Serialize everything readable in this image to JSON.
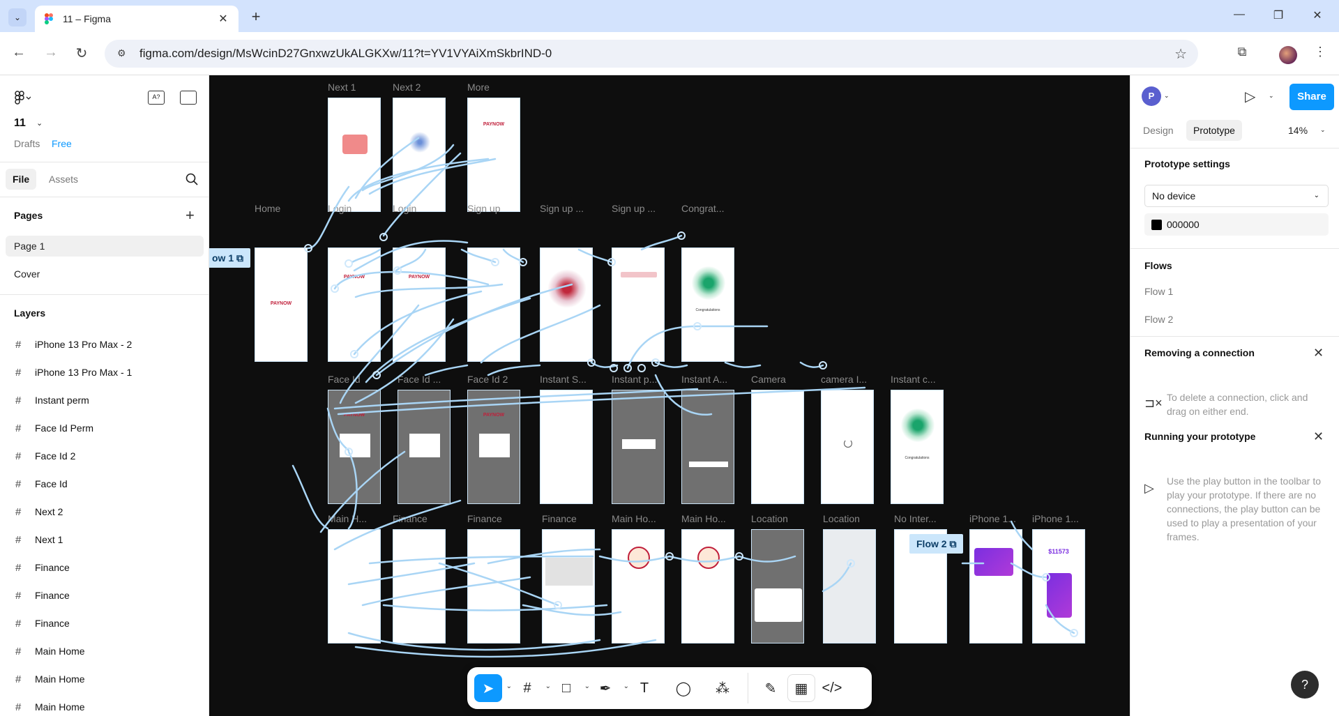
{
  "browser": {
    "tab_title": "11 – Figma",
    "url": "figma.com/design/MsWcinD27GnxwzUkALGKXw/11?t=YV1VYAiXmSkbrIND-0"
  },
  "left_panel": {
    "file_name": "11",
    "drafts": "Drafts",
    "plan": "Free",
    "tab_file": "File",
    "tab_assets": "Assets",
    "pages_heading": "Pages",
    "pages": [
      "Page 1",
      "Cover"
    ],
    "layers_heading": "Layers",
    "layers": [
      "iPhone 13 Pro Max - 2",
      "iPhone 13 Pro Max - 1",
      "Instant perm",
      "Face Id Perm",
      "Face Id 2",
      "Face Id",
      "Next 2",
      "Next 1",
      "Finance",
      "Finance",
      "Finance",
      "Main Home",
      "Main Home",
      "Main Home"
    ]
  },
  "canvas": {
    "row1": [
      "Next 1",
      "Next 2",
      "More"
    ],
    "row2": [
      "Home",
      "Login",
      "Login",
      "Sign up",
      "Sign up ...",
      "Sign up ...",
      "Congrat..."
    ],
    "row3": [
      "Face Id",
      "Face Id ...",
      "Face Id 2",
      "Instant S...",
      "Instant p...",
      "Instant A...",
      "Camera",
      "camera I...",
      "Instant c..."
    ],
    "row4": [
      "Main H...",
      "Finance",
      "Finance",
      "Finance",
      "Main Ho...",
      "Main Ho...",
      "Location",
      "Location",
      "No Inter...",
      "iPhone 1...",
      "iPhone 1..."
    ],
    "flow1": "ow 1",
    "flow2": "Flow 2",
    "brand": "PAYNOW",
    "congrats": "Congratulations",
    "amount": "$11573"
  },
  "right_panel": {
    "avatar_letter": "P",
    "share": "Share",
    "tab_design": "Design",
    "tab_prototype": "Prototype",
    "zoom": "14%",
    "proto_settings": "Prototype settings",
    "device": "No device",
    "bg_color": "000000",
    "flows_heading": "Flows",
    "flows": [
      "Flow 1",
      "Flow 2"
    ],
    "tip1_title": "Removing a connection",
    "tip1_text": "To delete a connection, click and drag on either end.",
    "tip2_title": "Running your prototype",
    "tip2_text": "Use the play button in the toolbar to play your prototype. If there are no connections, the play button can be used to play a presentation of your frames."
  }
}
